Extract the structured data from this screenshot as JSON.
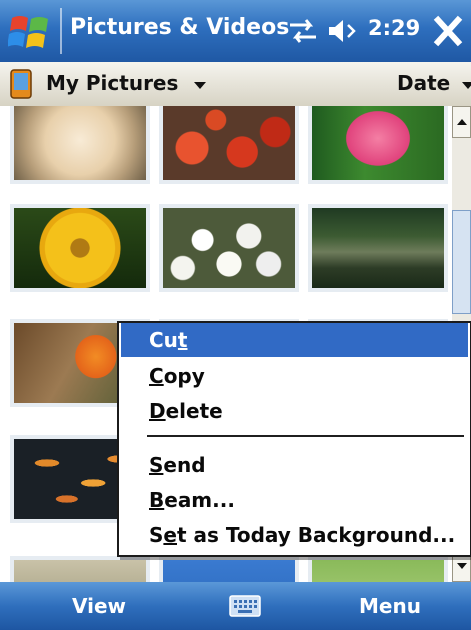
{
  "title_bar": {
    "app_title": "Pictures & Videos",
    "time": "2:29",
    "icons": [
      "windows-start-icon",
      "connectivity-icon",
      "volume-icon",
      "close-icon"
    ]
  },
  "toolbar": {
    "folder": "My Pictures",
    "sort": "Date"
  },
  "grid": {
    "thumbnails": [
      "white hydrangea",
      "red tomatoes",
      "pink tulip",
      "yellow flower",
      "white flower cluster",
      "garden pond",
      "orange bird of paradise",
      "",
      "",
      "koi fish",
      "",
      "",
      "",
      "",
      ""
    ]
  },
  "context_menu": {
    "items": [
      {
        "pre": "Cu",
        "acc": "t",
        "post": "",
        "selected": true
      },
      {
        "pre": "",
        "acc": "C",
        "post": "opy",
        "selected": false
      },
      {
        "pre": "",
        "acc": "D",
        "post": "elete",
        "selected": false
      },
      {
        "pre": "",
        "acc": "S",
        "post": "end",
        "selected": false
      },
      {
        "pre": "",
        "acc": "B",
        "post": "eam...",
        "selected": false
      },
      {
        "pre": "S",
        "acc": "e",
        "post": "t as Today Background...",
        "selected": false
      }
    ]
  },
  "softkeys": {
    "left": "View",
    "right": "Menu"
  },
  "colors": {
    "titlebar": "#2e6fbe",
    "menu_highlight": "#316ac5"
  }
}
